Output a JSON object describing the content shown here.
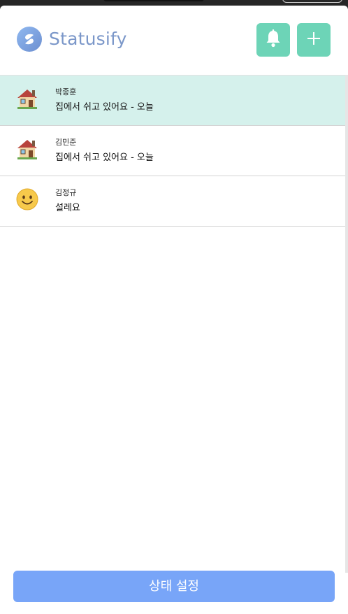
{
  "app": {
    "brand_name": "Statusify",
    "accent_color": "#6dd4b7",
    "brand_color": "#7b97c9"
  },
  "header": {
    "buttons": [
      {
        "icon": "bell-icon"
      },
      {
        "icon": "plus-icon"
      }
    ]
  },
  "users": [
    {
      "name": "박종훈",
      "status": "집에서 쉬고 있어요 - 오늘",
      "emoji": "house",
      "active": true
    },
    {
      "name": "김민준",
      "status": "집에서 쉬고 있어요 - 오늘",
      "emoji": "house",
      "active": false
    },
    {
      "name": "김정규",
      "status": "설레요",
      "emoji": "smile",
      "active": false
    }
  ],
  "footer": {
    "set_status_label": "상태 설정",
    "button_color": "#78a5f8"
  }
}
